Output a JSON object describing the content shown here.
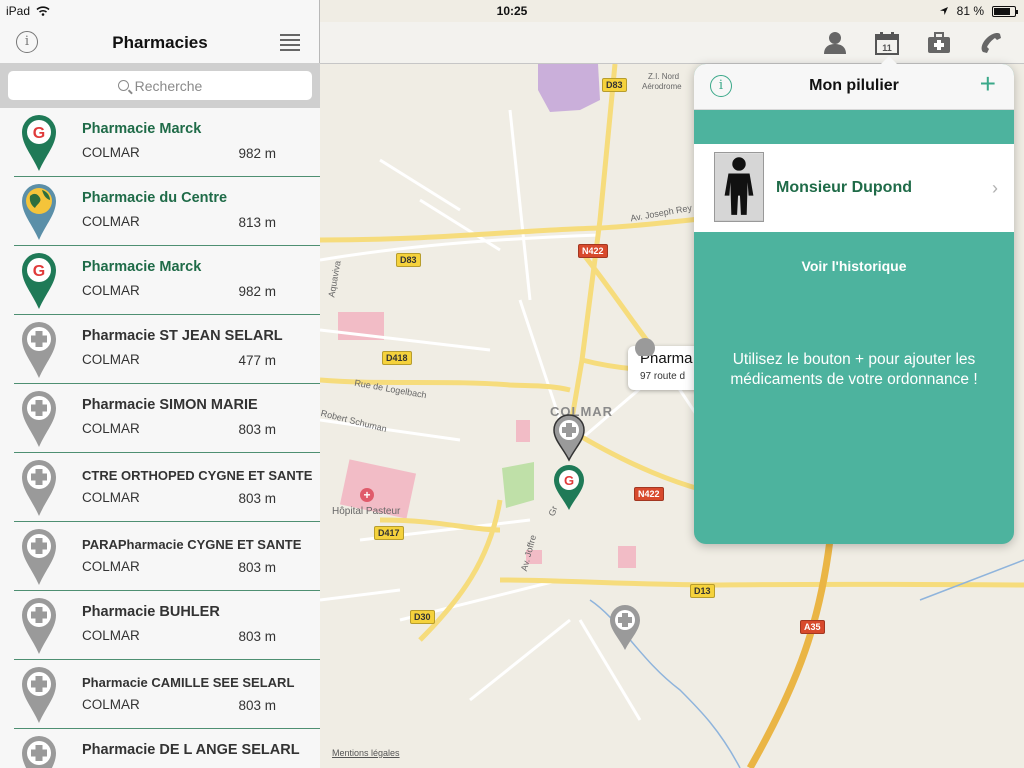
{
  "status": {
    "device": "iPad",
    "time": "10:25",
    "battery": "81 %",
    "battery_level": 0.81
  },
  "sidebar": {
    "title": "Pharmacies",
    "search_placeholder": "Recherche",
    "pharmacies": [
      {
        "name": "Pharmacie Marck",
        "city": "COLMAR",
        "distance": "982 m",
        "icon": "g-green-pin",
        "highlight": true
      },
      {
        "name": "Pharmacie du Centre",
        "city": "COLMAR",
        "distance": "813 m",
        "icon": "globe-blue-pin",
        "highlight": true
      },
      {
        "name": "Pharmacie Marck",
        "city": "COLMAR",
        "distance": "982 m",
        "icon": "g-green-pin",
        "highlight": true
      },
      {
        "name": "Pharmacie ST JEAN SELARL",
        "city": "COLMAR",
        "distance": "477 m",
        "icon": "cross-gray-pin",
        "highlight": false
      },
      {
        "name": "Pharmacie SIMON MARIE",
        "city": "COLMAR",
        "distance": "803 m",
        "icon": "cross-gray-pin",
        "highlight": false
      },
      {
        "name": "CTRE ORTHOPED CYGNE ET SANTE",
        "city": "COLMAR",
        "distance": "803 m",
        "icon": "cross-gray-pin",
        "highlight": false
      },
      {
        "name": "PARAPharmacie CYGNE ET SANTE",
        "city": "COLMAR",
        "distance": "803 m",
        "icon": "cross-gray-pin",
        "highlight": false
      },
      {
        "name": "Pharmacie BUHLER",
        "city": "COLMAR",
        "distance": "803 m",
        "icon": "cross-gray-pin",
        "highlight": false
      },
      {
        "name": "Pharmacie CAMILLE SEE SELARL",
        "city": "COLMAR",
        "distance": "803 m",
        "icon": "cross-gray-pin",
        "highlight": false
      },
      {
        "name": "Pharmacie DE L ANGE SELARL",
        "city": "",
        "distance": "",
        "icon": "cross-gray-pin",
        "highlight": false
      }
    ]
  },
  "popover": {
    "title": "Mon pilulier",
    "patient_name": "Monsieur Dupond",
    "history_link": "Voir l'historique",
    "hint": "Utilisez le bouton + pour ajouter les médicaments de votre ordonnance !"
  },
  "map": {
    "callout_title": "Pharma",
    "callout_subtitle": "97 route d",
    "legal": "Mentions légales",
    "labels": {
      "city": "COLMAR",
      "hospital": "Hôpital Pasteur",
      "logelbach": "Rue de Logelbach",
      "schuman": "Robert Schuman",
      "joseph": "Av. Joseph Rey",
      "joffre": "Av. Joffre",
      "aquaviva": "Aquaviva",
      "gr": "Gr",
      "zi": "Z.I. Nord",
      "aero": "Aérodrome"
    },
    "roads": {
      "d83a": "D83",
      "d83b": "D83",
      "n422a": "N422",
      "n422b": "N422",
      "d418": "D418",
      "d417": "D417",
      "d13": "D13",
      "d30": "D30",
      "a35": "A35"
    }
  },
  "colors": {
    "accent": "#4db39e",
    "brand_green": "#1f6b48",
    "road_yellow": "#f5d23c",
    "road_red": "#d84a2d"
  }
}
